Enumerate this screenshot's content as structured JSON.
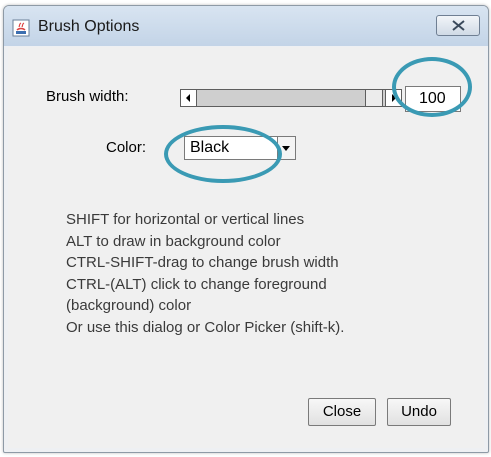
{
  "window": {
    "title": "Brush Options"
  },
  "form": {
    "brush_width_label": "Brush width:",
    "brush_width_value": "100",
    "color_label": "Color:",
    "color_value": "Black"
  },
  "help": {
    "lines": [
      "SHIFT for horizontal or vertical lines",
      "ALT to draw in background color",
      "CTRL-SHIFT-drag to change brush width",
      "CTRL-(ALT) click to change foreground",
      "(background) color",
      "Or use this dialog or Color Picker (shift-k)."
    ]
  },
  "buttons": {
    "close_label": "Close",
    "undo_label": "Undo"
  },
  "colors": {
    "highlight_ring": "#3a9ab4",
    "titlebar": "#c3d4e7",
    "client_bg": "#f0f0f0"
  },
  "icons": {
    "title_icon": "java-app-icon",
    "window_close": "close-icon"
  }
}
